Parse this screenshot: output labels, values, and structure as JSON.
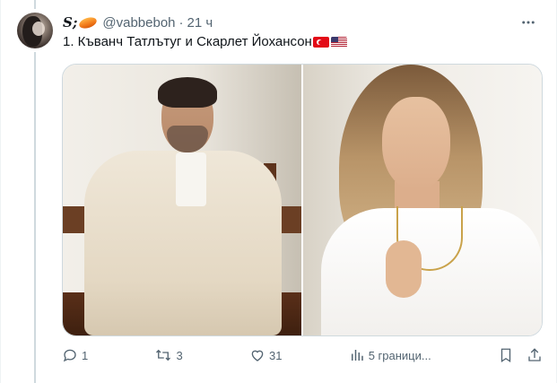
{
  "tweet": {
    "display_name": "S;",
    "handle": "@vabbeboh",
    "separator": "·",
    "time": "21 ч",
    "text": "1. Къванч Татлътуг и Скарлет Йохансон",
    "flags": [
      "flag-tr",
      "flag-us"
    ],
    "more_icon": "more-horizontal-icon"
  },
  "media": {
    "images": [
      {
        "label": "photo-left"
      },
      {
        "label": "photo-right"
      }
    ]
  },
  "actions": {
    "reply_count": "1",
    "retweet_count": "3",
    "like_count": "31",
    "views_text": "5 граници...",
    "icons": [
      "reply-icon",
      "retweet-icon",
      "like-icon",
      "views-icon",
      "bookmark-icon",
      "share-icon"
    ]
  },
  "colors": {
    "text_primary": "#0f1419",
    "text_secondary": "#536471",
    "border": "#cfd9de"
  }
}
